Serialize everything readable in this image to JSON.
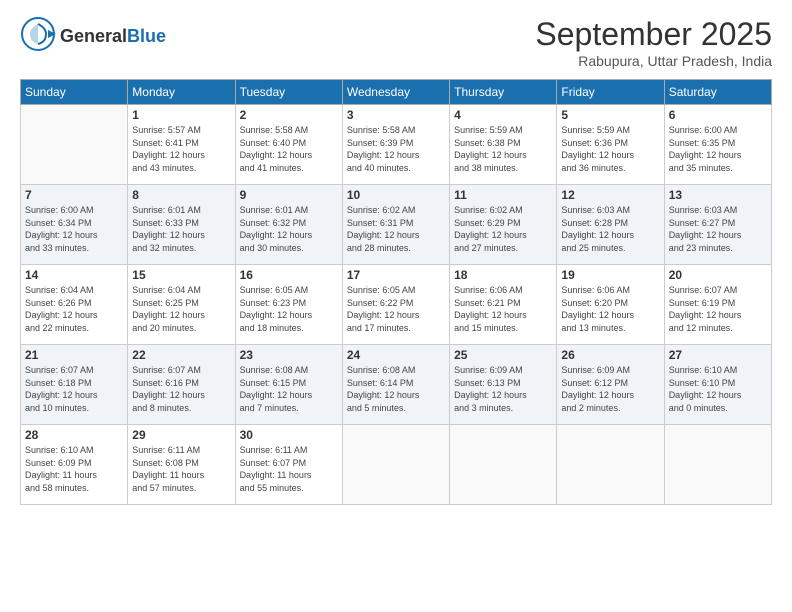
{
  "logo": {
    "general": "General",
    "blue": "Blue"
  },
  "header": {
    "month": "September 2025",
    "location": "Rabupura, Uttar Pradesh, India"
  },
  "days_of_week": [
    "Sunday",
    "Monday",
    "Tuesday",
    "Wednesday",
    "Thursday",
    "Friday",
    "Saturday"
  ],
  "weeks": [
    [
      {
        "day": "",
        "info": ""
      },
      {
        "day": "1",
        "info": "Sunrise: 5:57 AM\nSunset: 6:41 PM\nDaylight: 12 hours\nand 43 minutes."
      },
      {
        "day": "2",
        "info": "Sunrise: 5:58 AM\nSunset: 6:40 PM\nDaylight: 12 hours\nand 41 minutes."
      },
      {
        "day": "3",
        "info": "Sunrise: 5:58 AM\nSunset: 6:39 PM\nDaylight: 12 hours\nand 40 minutes."
      },
      {
        "day": "4",
        "info": "Sunrise: 5:59 AM\nSunset: 6:38 PM\nDaylight: 12 hours\nand 38 minutes."
      },
      {
        "day": "5",
        "info": "Sunrise: 5:59 AM\nSunset: 6:36 PM\nDaylight: 12 hours\nand 36 minutes."
      },
      {
        "day": "6",
        "info": "Sunrise: 6:00 AM\nSunset: 6:35 PM\nDaylight: 12 hours\nand 35 minutes."
      }
    ],
    [
      {
        "day": "7",
        "info": "Sunrise: 6:00 AM\nSunset: 6:34 PM\nDaylight: 12 hours\nand 33 minutes."
      },
      {
        "day": "8",
        "info": "Sunrise: 6:01 AM\nSunset: 6:33 PM\nDaylight: 12 hours\nand 32 minutes."
      },
      {
        "day": "9",
        "info": "Sunrise: 6:01 AM\nSunset: 6:32 PM\nDaylight: 12 hours\nand 30 minutes."
      },
      {
        "day": "10",
        "info": "Sunrise: 6:02 AM\nSunset: 6:31 PM\nDaylight: 12 hours\nand 28 minutes."
      },
      {
        "day": "11",
        "info": "Sunrise: 6:02 AM\nSunset: 6:29 PM\nDaylight: 12 hours\nand 27 minutes."
      },
      {
        "day": "12",
        "info": "Sunrise: 6:03 AM\nSunset: 6:28 PM\nDaylight: 12 hours\nand 25 minutes."
      },
      {
        "day": "13",
        "info": "Sunrise: 6:03 AM\nSunset: 6:27 PM\nDaylight: 12 hours\nand 23 minutes."
      }
    ],
    [
      {
        "day": "14",
        "info": "Sunrise: 6:04 AM\nSunset: 6:26 PM\nDaylight: 12 hours\nand 22 minutes."
      },
      {
        "day": "15",
        "info": "Sunrise: 6:04 AM\nSunset: 6:25 PM\nDaylight: 12 hours\nand 20 minutes."
      },
      {
        "day": "16",
        "info": "Sunrise: 6:05 AM\nSunset: 6:23 PM\nDaylight: 12 hours\nand 18 minutes."
      },
      {
        "day": "17",
        "info": "Sunrise: 6:05 AM\nSunset: 6:22 PM\nDaylight: 12 hours\nand 17 minutes."
      },
      {
        "day": "18",
        "info": "Sunrise: 6:06 AM\nSunset: 6:21 PM\nDaylight: 12 hours\nand 15 minutes."
      },
      {
        "day": "19",
        "info": "Sunrise: 6:06 AM\nSunset: 6:20 PM\nDaylight: 12 hours\nand 13 minutes."
      },
      {
        "day": "20",
        "info": "Sunrise: 6:07 AM\nSunset: 6:19 PM\nDaylight: 12 hours\nand 12 minutes."
      }
    ],
    [
      {
        "day": "21",
        "info": "Sunrise: 6:07 AM\nSunset: 6:18 PM\nDaylight: 12 hours\nand 10 minutes."
      },
      {
        "day": "22",
        "info": "Sunrise: 6:07 AM\nSunset: 6:16 PM\nDaylight: 12 hours\nand 8 minutes."
      },
      {
        "day": "23",
        "info": "Sunrise: 6:08 AM\nSunset: 6:15 PM\nDaylight: 12 hours\nand 7 minutes."
      },
      {
        "day": "24",
        "info": "Sunrise: 6:08 AM\nSunset: 6:14 PM\nDaylight: 12 hours\nand 5 minutes."
      },
      {
        "day": "25",
        "info": "Sunrise: 6:09 AM\nSunset: 6:13 PM\nDaylight: 12 hours\nand 3 minutes."
      },
      {
        "day": "26",
        "info": "Sunrise: 6:09 AM\nSunset: 6:12 PM\nDaylight: 12 hours\nand 2 minutes."
      },
      {
        "day": "27",
        "info": "Sunrise: 6:10 AM\nSunset: 6:10 PM\nDaylight: 12 hours\nand 0 minutes."
      }
    ],
    [
      {
        "day": "28",
        "info": "Sunrise: 6:10 AM\nSunset: 6:09 PM\nDaylight: 11 hours\nand 58 minutes."
      },
      {
        "day": "29",
        "info": "Sunrise: 6:11 AM\nSunset: 6:08 PM\nDaylight: 11 hours\nand 57 minutes."
      },
      {
        "day": "30",
        "info": "Sunrise: 6:11 AM\nSunset: 6:07 PM\nDaylight: 11 hours\nand 55 minutes."
      },
      {
        "day": "",
        "info": ""
      },
      {
        "day": "",
        "info": ""
      },
      {
        "day": "",
        "info": ""
      },
      {
        "day": "",
        "info": ""
      }
    ]
  ]
}
